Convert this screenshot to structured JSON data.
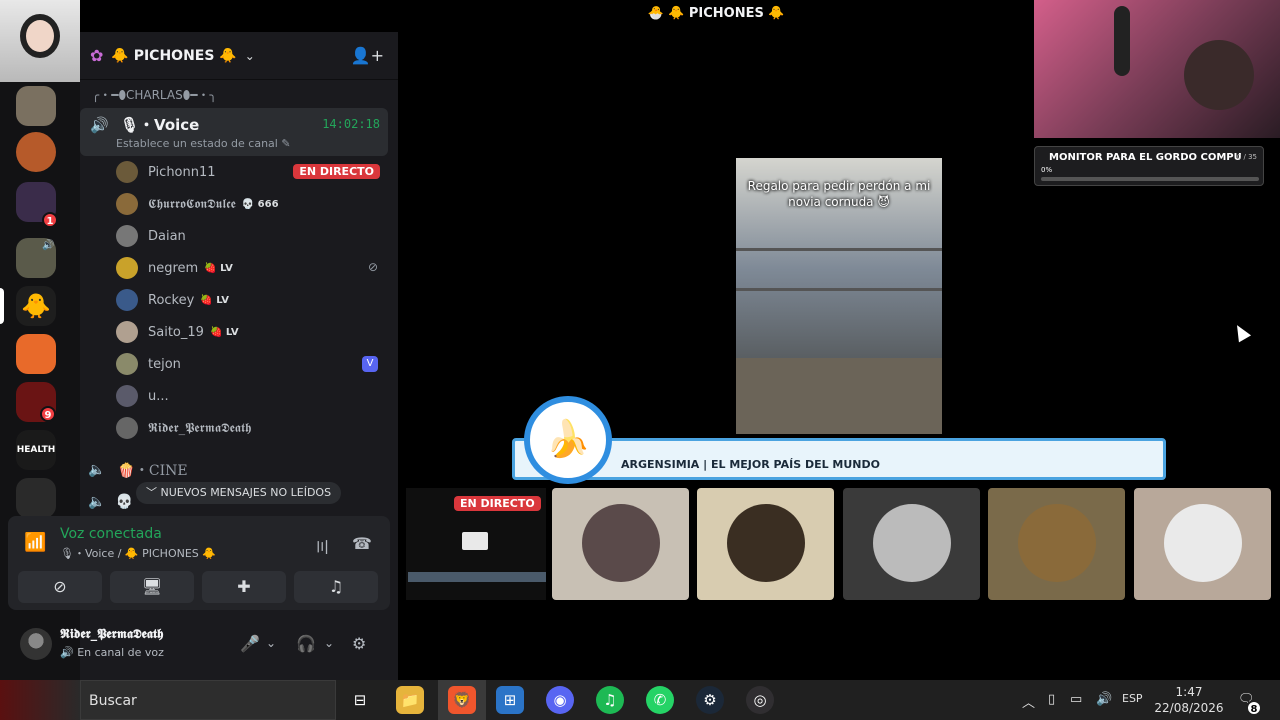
{
  "window": {
    "title": "🐣 🐥 PICHONES 🐥"
  },
  "server": {
    "name": "🐥 PICHONES 🐥"
  },
  "category": "╭・━⬮CHARLAS⬮━・╮",
  "voice_channel": {
    "name": "🎙・Voice",
    "timer": "14:02:18",
    "status_placeholder": "Establece un estado de canal ✎"
  },
  "members": [
    {
      "name": "Pichonn11",
      "extra": "",
      "live": "EN DIRECTO"
    },
    {
      "name": "𝕮𝖍𝖚𝖗𝖗𝖔𝕮𝖔𝖓𝕯𝖚𝖑𝖈𝖊",
      "extra": "💀 666"
    },
    {
      "name": "Daian",
      "extra": ""
    },
    {
      "name": "negrem",
      "extra": "🍓 LV"
    },
    {
      "name": "Rockey",
      "extra": "🍓 LV"
    },
    {
      "name": "Saito_19",
      "extra": "🍓 LV"
    },
    {
      "name": "tejon",
      "extra": "",
      "badge": "V"
    },
    {
      "name": "u...",
      "extra": ""
    },
    {
      "name": "𝕽𝖎𝖉𝖊𝖗_𝕻𝖊𝖗𝖒𝖆𝕯𝖊𝖆𝖙𝖍",
      "extra": ""
    }
  ],
  "other_channels": [
    "🍿・CINE"
  ],
  "unread_pill": "﹀ NUEVOS MENSAJES NO LEÍDOS",
  "voice_panel": {
    "title": "Voz conectada",
    "subtitle": "🎙・Voice / 🐥 PICHONES 🐥"
  },
  "user": {
    "name": "𝕽𝖎𝖉𝖊𝖗_𝕻𝖊𝖗𝖒𝖆𝕯𝖊𝖆𝖙𝖍",
    "status": "🔊 En canal de voz"
  },
  "rail": {
    "badges": [
      "1",
      "9"
    ],
    "health_label": "HEALTH"
  },
  "stream": {
    "caption": "Regalo para pedir perdón a mi novia cornuda 😈",
    "banner": "ARGENSIMIA | EL MEJOR PAÍS DEL MUNDO",
    "live_tag": "EN DIRECTO"
  },
  "goal": {
    "title": "MONITOR PARA EL GORDO COMPU",
    "count": "0 / 35",
    "percent": "0%",
    "progress": 0
  },
  "taskbar": {
    "search": "Buscar",
    "lang": "ESP",
    "time": "1:47",
    "date": "22/08/2026",
    "notifications": "8"
  },
  "colors": {
    "accent_green": "#23a55a",
    "live_red": "#da373c",
    "blurple": "#5865f2"
  }
}
